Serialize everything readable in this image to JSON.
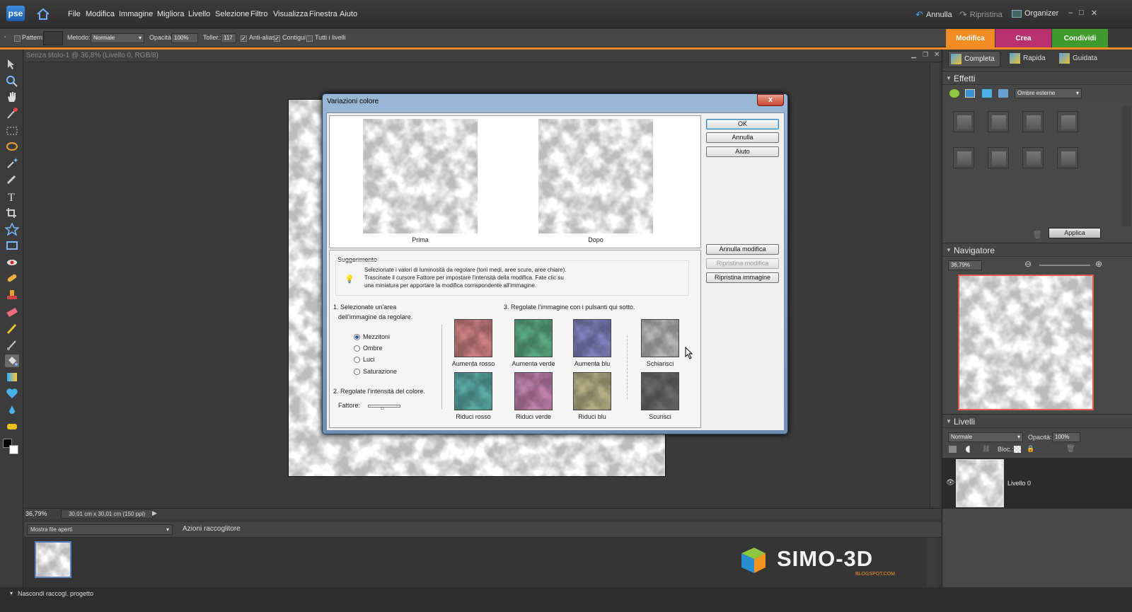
{
  "app": {
    "logo": "pse"
  },
  "menu": [
    "File",
    "Modifica",
    "Immagine",
    "Migliora",
    "Livello",
    "Selezione",
    "Filtro",
    "Visualizza",
    "Finestra",
    "Aiuto"
  ],
  "top_actions": {
    "undo": "Annulla",
    "redo": "Ripristina",
    "organizer": "Organizer"
  },
  "options": {
    "pattern": "Pattern",
    "method_label": "Metodo:",
    "method_value": "Normale",
    "opacity_label": "Opacità:",
    "opacity_value": "100%",
    "tolerance_label": "Toller.:",
    "tolerance_value": "117",
    "antialias": "Anti-alias",
    "contiguous": "Contigui",
    "all_layers": "Tutti i livelli",
    "antialias_checked": true,
    "contiguous_checked": true,
    "all_layers_checked": false
  },
  "mode_tabs": [
    {
      "label": "Modifica",
      "color": "#f28b21"
    },
    {
      "label": "Crea",
      "color": "#b8306e"
    },
    {
      "label": "Condividi",
      "color": "#3f9a2c"
    }
  ],
  "sub_tabs": [
    "Completa",
    "Rapida",
    "Guidata"
  ],
  "document": {
    "title": "Senza titolo-1 @ 36,8% (Livello 0, RGB/8)",
    "zoom": "36,79%",
    "size": "30,01 cm x 30,01 cm (150 ppi)"
  },
  "bin": {
    "dropdown": "Mostra file aperti",
    "actions": "Azioni raccoglitore"
  },
  "bottom": {
    "hide_bin": "Nascondi raccogl. progetto"
  },
  "watermark": {
    "brand": "SIMO-3D",
    "sub": "BLOGSPOT.COM"
  },
  "effects": {
    "title": "Effetti",
    "dropdown": "Ombre esterne",
    "apply": "Applica"
  },
  "navigator": {
    "title": "Navigatore",
    "zoom": "36,79%"
  },
  "layers": {
    "title": "Livelli",
    "blend": "Normale",
    "opacity_label": "Opacità:",
    "opacity_value": "100%",
    "lock_label": "Bloc.:",
    "layer_name": "Livello 0"
  },
  "dialog": {
    "title": "Variazioni colore",
    "close": "x",
    "before": "Prima",
    "after": "Dopo",
    "buttons": {
      "ok": "OK",
      "cancel": "Annulla",
      "help": "Aiuto",
      "undo": "Annulla modifica",
      "redo": "Ripristina modifica",
      "reset": "Ripristina immagine"
    },
    "hint_title": "Suggerimento",
    "hint_lines": [
      "Selezionate i valori di luminosità da regolare (toni medi, aree scure, aree chiare).",
      "Trascinate il cursore Fattore per impostare l'intensità della modifica. Fate clic su",
      "una miniatura per apportare la modifica corrispondente all'immagine."
    ],
    "step1a": "1. Selezionate un'area",
    "step1b": "dell'immagine da regolare.",
    "areas": [
      "Mezzitoni",
      "Ombre",
      "Luci",
      "Saturazione"
    ],
    "selected_area": "Mezzitoni",
    "step2": "2. Regolate l'intensità del colore.",
    "factor_label": "Fattore:",
    "step3": "3. Regolate l'immagine con i pulsanti qui sotto.",
    "variations": [
      {
        "label": "Aumenta rosso",
        "tint": "#c46a6a"
      },
      {
        "label": "Aumenta verde",
        "tint": "#3e9a6c"
      },
      {
        "label": "Aumenta blu",
        "tint": "#6a6ab0"
      },
      {
        "label": "Schiarisci",
        "tint": "#a8a8a8"
      },
      {
        "label": "Riduci rosso",
        "tint": "#3c9a98"
      },
      {
        "label": "Riduci verde",
        "tint": "#b46aa0"
      },
      {
        "label": "Riduci blu",
        "tint": "#a8a070"
      },
      {
        "label": "Scurisci",
        "tint": "#505050"
      }
    ]
  }
}
